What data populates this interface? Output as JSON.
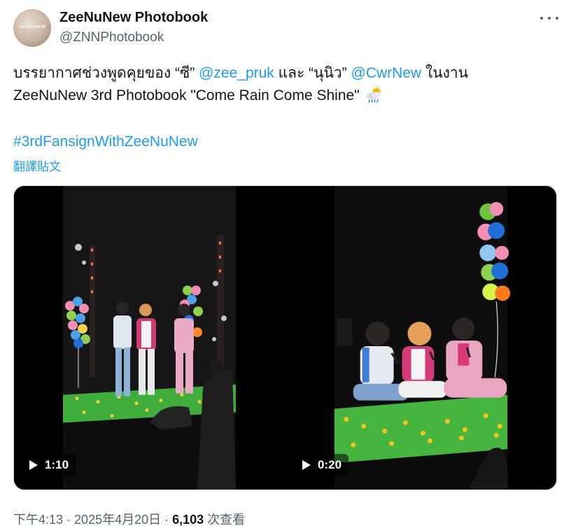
{
  "author": {
    "display_name": "ZeeNuNew Photobook",
    "handle": "@ZNNPhotobook",
    "avatar_mark": "ZEENUNEW"
  },
  "tweet": {
    "line1": {
      "part1": "บรรยากาศช่วงพูดคุยของ “ซี” ",
      "mention1": "@zee_pruk",
      "part2": " และ “นุนิว” ",
      "mention2": "@CwrNew",
      "part3": " ในงาน"
    },
    "line2": "ZeeNuNew 3rd Photobook \"Come Rain Come Shine\"",
    "emoji_icon": "sun-behind-rain-cloud-icon",
    "hashtag": "#3rdFansignWithZeeNuNew",
    "translate_label": "翻譯貼文"
  },
  "media": {
    "videos": [
      {
        "duration": "1:10"
      },
      {
        "duration": "0:20"
      }
    ]
  },
  "meta": {
    "time": "下午4:13",
    "separator1": " · ",
    "date": "2025年4月20日",
    "separator2": " · ",
    "views": "6,103",
    "views_label": " 次查看"
  },
  "colors": {
    "link": "#1d9bf0",
    "text": "#0f1419",
    "secondary": "#536471"
  }
}
